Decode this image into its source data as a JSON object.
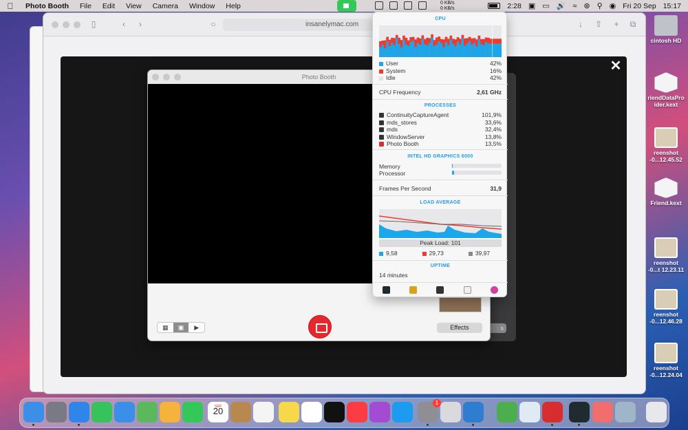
{
  "menubar": {
    "app_name": "Photo Booth",
    "menus": [
      "File",
      "Edit",
      "View",
      "Camera",
      "Window",
      "Help"
    ],
    "net_up": "0 KB/s",
    "net_down": "0 KB/s",
    "time_top": "2:28",
    "date": "Fri 20 Sep",
    "clock": "15:17"
  },
  "desktop_icons": [
    {
      "label": "cintosh HD",
      "kind": "disk"
    },
    {
      "label": "riendDataPro\nider.kext",
      "kind": "kext"
    },
    {
      "label": "reenshot\n-0...12.45.52",
      "kind": "shot"
    },
    {
      "label": "Friend.kext",
      "kind": "kext"
    },
    {
      "label": "reenshot\n-0...t 12.23.11",
      "kind": "shot"
    },
    {
      "label": "reenshot\n-0...12.46.28",
      "kind": "shot"
    },
    {
      "label": "reenshot\n-0...12.24.04",
      "kind": "shot"
    }
  ],
  "safari": {
    "url": "insanelymac.com"
  },
  "photo_booth": {
    "title": "Photo Booth",
    "effects_label": "Effects",
    "bg_button_label": "s"
  },
  "stats": {
    "cpu": {
      "header": "CPU",
      "user_label": "User",
      "user_value": "42%",
      "system_label": "System",
      "system_value": "16%",
      "idle_label": "Idle",
      "idle_value": "42%",
      "user_pct": 42,
      "system_pct": 16,
      "colors": {
        "user": "#1aa7ec",
        "system": "#ee3b2d",
        "idle": "#e3e3e5"
      },
      "history_user": [
        32,
        40,
        28,
        50,
        35,
        45,
        38,
        60,
        42,
        30,
        55,
        40,
        36,
        48,
        52,
        33,
        44,
        39,
        58,
        41,
        37,
        46,
        62,
        35,
        40,
        50,
        44,
        31,
        47,
        38,
        56,
        42,
        35,
        49,
        40,
        60,
        36,
        43,
        51,
        39,
        45,
        34,
        57,
        41,
        38,
        48,
        44,
        42
      ],
      "history_system": [
        18,
        12,
        25,
        14,
        20,
        16,
        22,
        10,
        19,
        24,
        13,
        21,
        17,
        15,
        12,
        23,
        18,
        20,
        11,
        16,
        24,
        14,
        10,
        19,
        22,
        15,
        13,
        25,
        17,
        20,
        12,
        16,
        21,
        14,
        18,
        10,
        23,
        17,
        13,
        20,
        15,
        22,
        11,
        16,
        19,
        14,
        17,
        16
      ]
    },
    "cpu_frequency_label": "CPU Frequency",
    "cpu_frequency_value": "2,61 GHz",
    "processes": {
      "header": "PROCESSES",
      "items": [
        {
          "name": "ContinuityCaptureAgent",
          "value": "101,9%"
        },
        {
          "name": "mds_stores",
          "value": "33,6%"
        },
        {
          "name": "mds",
          "value": "32,4%"
        },
        {
          "name": "WindowServer",
          "value": "13,8%"
        },
        {
          "name": "Photo Booth",
          "value": "13,5%"
        }
      ]
    },
    "gpu": {
      "header": "INTEL HD GRAPHICS 6000",
      "memory_label": "Memory",
      "memory_pct": 2,
      "processor_label": "Processor",
      "processor_pct": 4
    },
    "fps_label": "Frames Per Second",
    "fps_value": "31,9",
    "load": {
      "header": "LOAD AVERAGE",
      "peak_label": "Peak Load: 101",
      "load1": "9,58",
      "load5": "29,73",
      "load15": "39,97",
      "colors": {
        "load1": "#1aa7ec",
        "load5": "#ee3b2d",
        "load15": "#888888"
      }
    },
    "uptime": {
      "header": "UPTIME",
      "value": "14 minutes"
    }
  },
  "dock": {
    "calendar_month": "SEP",
    "calendar_day": "20",
    "settings_badge": "1",
    "apps": [
      {
        "name": "finder",
        "color": "#3b8fe6"
      },
      {
        "name": "launchpad",
        "color": "#7a7a86"
      },
      {
        "name": "safari",
        "color": "#2d86e8"
      },
      {
        "name": "messages",
        "color": "#36c35b"
      },
      {
        "name": "mail",
        "color": "#3b8fe6"
      },
      {
        "name": "maps",
        "color": "#5cb85c"
      },
      {
        "name": "photos",
        "color": "#f3b33d"
      },
      {
        "name": "facetime",
        "color": "#34c759"
      },
      {
        "name": "calendar",
        "color": "#ffffff"
      },
      {
        "name": "contacts",
        "color": "#b7894e"
      },
      {
        "name": "reminders",
        "color": "#f4f4f4"
      },
      {
        "name": "notes",
        "color": "#f7d84a"
      },
      {
        "name": "freeform",
        "color": "#ffffff"
      },
      {
        "name": "tv",
        "color": "#111111"
      },
      {
        "name": "music",
        "color": "#fc3c44"
      },
      {
        "name": "podcasts",
        "color": "#a34bd3"
      },
      {
        "name": "app-store",
        "color": "#1d9bf0"
      },
      {
        "name": "system-settings",
        "color": "#8e8e93"
      },
      {
        "name": "iphone-mirroring",
        "color": "#d9d9de"
      },
      {
        "name": "intel-power-gadget",
        "color": "#2e7dd1"
      },
      {
        "name": "activity-monitor-green",
        "color": "#4cae4c"
      },
      {
        "name": "boost",
        "color": "#dfeaf5"
      },
      {
        "name": "photo-booth",
        "color": "#d62e2e"
      },
      {
        "name": "activity-monitor",
        "color": "#1f2b2f"
      },
      {
        "name": "pages-like",
        "color": "#f26d6d"
      },
      {
        "name": "preview",
        "color": "#9fb6c9"
      },
      {
        "name": "trash",
        "color": "#e8e8ec"
      }
    ]
  }
}
